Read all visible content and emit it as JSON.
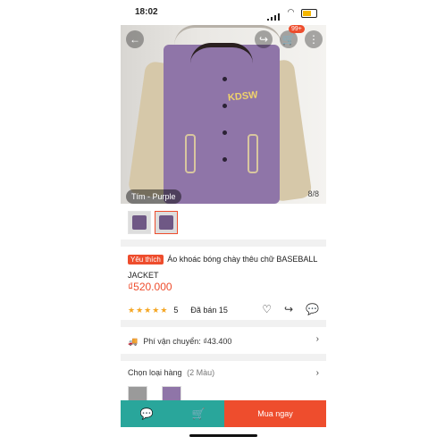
{
  "status_bar": {
    "time": "18:02"
  },
  "hero": {
    "variant_label": "Tím - Purple",
    "page_indicator": "8/8",
    "cart_badge": "99+",
    "logo_text": "KDSW"
  },
  "product": {
    "tag": "Yêu thích",
    "title": "Áo khoác bóng chày thêu chữ BASEBALL JACKET",
    "price": "₫520.000",
    "rating_value": "5",
    "sold_label": "Đã bán 15"
  },
  "shipping": {
    "label": "Phí vận chuyển: ₫43.400"
  },
  "variants": {
    "label": "Chọn loại hàng",
    "count": "(2 Màu)"
  },
  "bottom_bar": {
    "buy_now": "Mua ngay"
  },
  "icons": {
    "back": "back-arrow-icon",
    "share": "share-icon",
    "cart": "cart-icon",
    "more": "more-icon",
    "heart": "heart-icon",
    "chat": "chat-icon",
    "add_to_cart": "add-to-cart-icon",
    "truck": "truck-icon",
    "chevron": "chevron-right-icon"
  },
  "colors": {
    "accent": "#ee4d2d",
    "teal": "#29a69b",
    "star": "#f5a623",
    "jacket_purple": "#8f75a8"
  }
}
